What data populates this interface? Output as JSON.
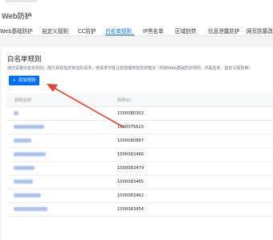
{
  "page": {
    "title": "Web防护"
  },
  "tabs": [
    {
      "label": "Web基础防护"
    },
    {
      "label": "自定义规则"
    },
    {
      "label": "CC防护"
    },
    {
      "label": "白名单规则"
    },
    {
      "label": "IP黑名单"
    },
    {
      "label": "区域封禁"
    },
    {
      "label": "信息泄露防护"
    },
    {
      "label": "网页防篡改"
    }
  ],
  "active_tab": "白名单规则",
  "card": {
    "title": "白名单规则",
    "description": "通过设置白名单规则，放行具有指定特征的请求。使请求不经过全部或特定防护模块（例如Web基础防护规则，IP黑名单、自定义规则等）",
    "add_button": {
      "icon": "plus-icon",
      "label": "添加规则"
    }
  },
  "table": {
    "columns": [
      "规则名称",
      "规则ID"
    ],
    "rows": [
      {
        "id": "1000080302"
      },
      {
        "id": "1000075615"
      },
      {
        "id": "1000080887"
      },
      {
        "id": "1000083466"
      },
      {
        "id": "1000083479"
      },
      {
        "id": "1000083465"
      },
      {
        "id": "1000083462"
      },
      {
        "id": "1000083454"
      }
    ]
  },
  "colors": {
    "accent": "#006eff",
    "annotation": "#e8432d"
  }
}
